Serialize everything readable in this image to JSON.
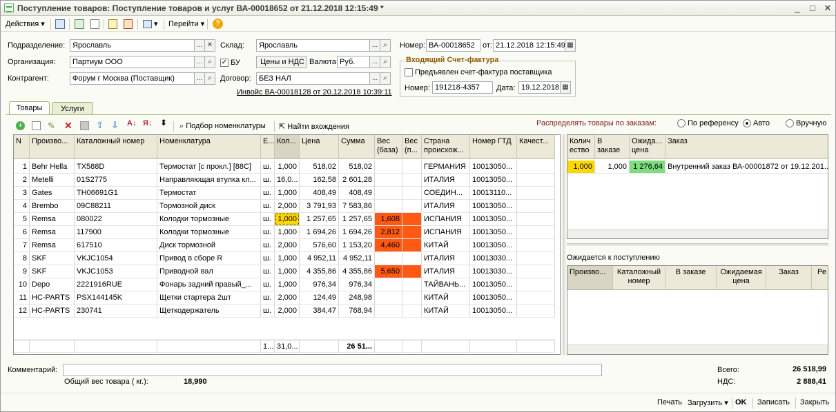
{
  "window": {
    "title": "Поступление товаров: Поступление товаров и услуг ВА-00018652 от 21.12.2018 12:15:49 *"
  },
  "toolbar": {
    "actions": "Действия",
    "goto": "Перейти"
  },
  "form": {
    "podr_label": "Подразделение:",
    "podr_value": "Ярославль",
    "org_label": "Организация:",
    "org_value": "Партиум ООО",
    "kontr_label": "Контрагент:",
    "kontr_value": "Форум г Москва (Поставщик)",
    "sklad_label": "Склад:",
    "sklad_value": "Ярославль",
    "bu_label": "БУ",
    "prices_value": "Цены и НДС",
    "valuta_label": "Валюта:",
    "valuta_value": "Руб.",
    "dogovor_label": "Договор:",
    "dogovor_value": "БЕЗ НАЛ",
    "invoice_link": "Инвойс ВА-00018128 от 20.12.2018 10:39:11",
    "nomer_label": "Номер:",
    "nomer_value": "ВА-00018652",
    "ot_label": "от:",
    "ot_value": "21.12.2018 12:15:49"
  },
  "sf": {
    "title": "Входящий Счет-фактура",
    "checkbox_label": "Предъявлен счет-фактура поставщика",
    "nomer_label": "Номер:",
    "nomer_value": "191218-4357",
    "date_label": "Дата:",
    "date_value": "19.12.2018"
  },
  "tabs": {
    "goods": "Товары",
    "services": "Услуги"
  },
  "gridbar": {
    "podbor": "Подбор номенклатуры",
    "find": "Найти вхождения",
    "distribute_label": "Распределять товары по заказам:",
    "opt_ref": "По референсу",
    "opt_auto": "Авто",
    "opt_manual": "Вручную"
  },
  "main_columns": [
    "N",
    "Произво...",
    "Каталожный номер",
    "Номенклатура",
    "Е...",
    "Кол...",
    "Цена",
    "Сумма",
    "Вес (база)",
    "Вес (п...",
    "Страна происхож...",
    "Номер ГТД",
    "Качест..."
  ],
  "main_rows": [
    [
      "1",
      "Behr Hella",
      "TX588D",
      "Термостат [с прокл.] [88С]",
      "ш.",
      "1,000",
      "518,02",
      "518,02",
      "",
      "",
      "ГЕРМАНИЯ",
      "10013050...",
      ""
    ],
    [
      "2",
      "Metelli",
      "01S2775",
      "Направляющая втулка кл...",
      "ш.",
      "16,0...",
      "162,58",
      "2 601,28",
      "",
      "",
      "ИТАЛИЯ",
      "10013050...",
      ""
    ],
    [
      "3",
      "Gates",
      "TH06691G1",
      "Термостат",
      "ш.",
      "1,000",
      "408,49",
      "408,49",
      "",
      "",
      "СОЕДИН...",
      "10013110...",
      ""
    ],
    [
      "4",
      "Brembo",
      "09C88211",
      "Тормозной диск",
      "ш.",
      "2,000",
      "3 791,93",
      "7 583,86",
      "",
      "",
      "ИТАЛИЯ",
      "10013050...",
      ""
    ],
    [
      "5",
      "Remsa",
      "080022",
      "Колодки тормозные",
      "ш.",
      "1,000",
      "1 257,65",
      "1 257,65",
      "1,608",
      "",
      "ИСПАНИЯ",
      "10013050...",
      ""
    ],
    [
      "6",
      "Remsa",
      "117900",
      "Колодки тормозные",
      "ш.",
      "1,000",
      "1 694,26",
      "1 694,26",
      "2,812",
      "",
      "ИСПАНИЯ",
      "10013050...",
      ""
    ],
    [
      "7",
      "Remsa",
      "617510",
      "Диск тормозной",
      "ш.",
      "2,000",
      "576,60",
      "1 153,20",
      "4,460",
      "",
      "КИТАЙ",
      "10013050...",
      ""
    ],
    [
      "8",
      "SKF",
      "VKJC1054",
      "Привод в сборе R",
      "ш.",
      "1,000",
      "4 952,11",
      "4 952,11",
      "",
      "",
      "ИТАЛИЯ",
      "10013030...",
      ""
    ],
    [
      "9",
      "SKF",
      "VKJC1053",
      "Приводной вал",
      "ш.",
      "1,000",
      "4 355,86",
      "4 355,86",
      "5,650",
      "",
      "ИТАЛИЯ",
      "10013030...",
      ""
    ],
    [
      "10",
      "Depo",
      "2221916RUE",
      "Фонарь задний правый_...",
      "ш.",
      "1,000",
      "976,34",
      "976,34",
      "",
      "",
      "ТАЙВАНЬ...",
      "10013050...",
      ""
    ],
    [
      "11",
      "HC-PARTS",
      "PSX144145K",
      "Щетки стартера  2шт",
      "ш.",
      "2,000",
      "124,49",
      "248,98",
      "",
      "",
      "КИТАЙ",
      "10013050...",
      ""
    ],
    [
      "12",
      "HC-PARTS",
      "230741",
      "Щеткодержатель",
      "ш.",
      "2,000",
      "384,47",
      "768,94",
      "",
      "",
      "КИТАЙ",
      "10013050...",
      ""
    ]
  ],
  "main_footer": [
    "",
    "",
    "",
    "",
    "1...",
    "31,0...",
    "",
    "26 51...",
    "",
    "",
    "",
    "",
    ""
  ],
  "right_top_columns": [
    "Колич ество",
    "В заказе",
    "Ожида... цена",
    "Заказ"
  ],
  "right_top_rows": [
    [
      "1,000",
      "1,000",
      "1 276,64",
      "Внутренний заказ ВА-00001872 от 19.12.201..."
    ]
  ],
  "right_bottom_label": "Ожидается к поступлению",
  "right_bottom_columns": [
    "Произво...",
    "Каталожный номер",
    "В заказе",
    "Ожидаемая цена",
    "Заказ",
    "Ре"
  ],
  "bottom": {
    "comment_label": "Комментарий:",
    "weight_label": "Общий вес товара ( кг.):",
    "weight_value": "18,990",
    "total_label": "Всего:",
    "total_value": "26 518,99",
    "nds_label": "НДС:",
    "nds_value": "2 888,41"
  },
  "footer_buttons": {
    "print": "Печать",
    "load": "Загрузить",
    "ok": "OK",
    "save": "Записать",
    "close": "Закрыть"
  },
  "colors": {
    "qty_highlight": "#ffd700",
    "weight_highlight": "#ff5a14",
    "price_green": "#7fdc7f"
  }
}
